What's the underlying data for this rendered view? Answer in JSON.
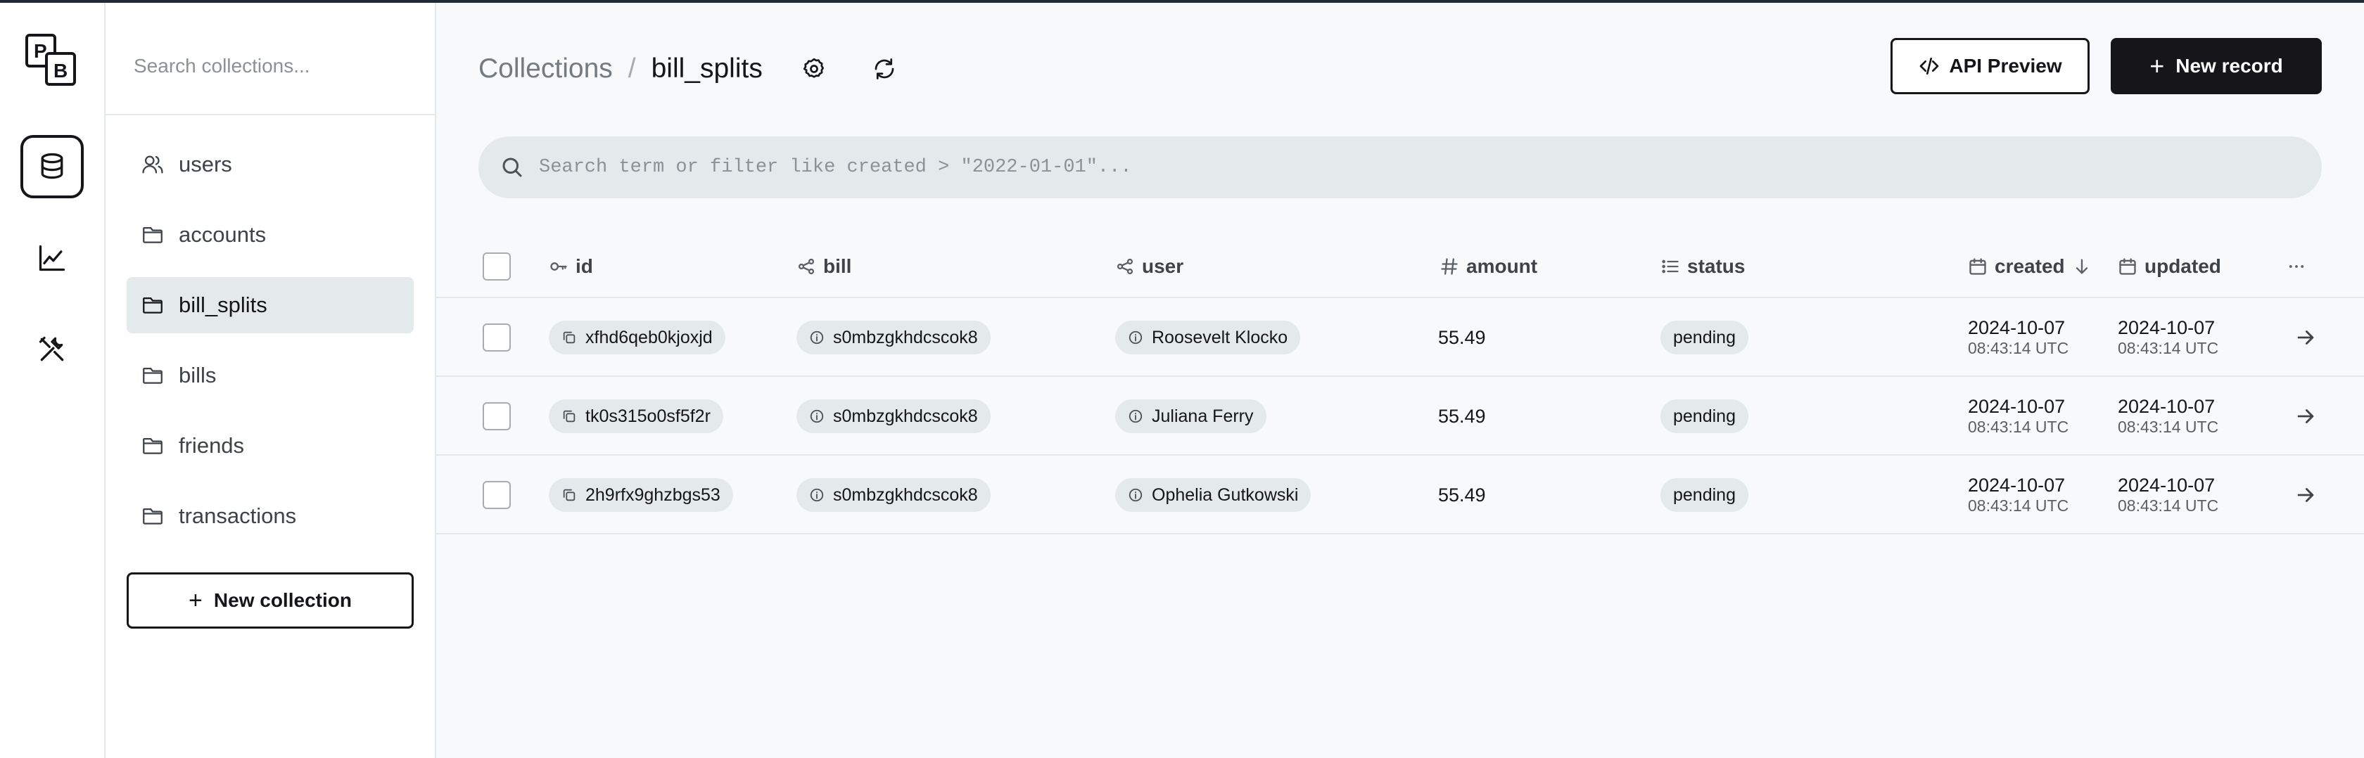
{
  "app": {
    "logo_letters": [
      "P",
      "B"
    ],
    "nav_icons": [
      "database-icon",
      "chart-icon",
      "tools-icon"
    ]
  },
  "sidebar": {
    "search_placeholder": "Search collections...",
    "items": [
      {
        "label": "users",
        "icon": "users-icon"
      },
      {
        "label": "accounts",
        "icon": "folder-icon"
      },
      {
        "label": "bill_splits",
        "icon": "folder-icon",
        "active": true
      },
      {
        "label": "bills",
        "icon": "folder-icon"
      },
      {
        "label": "friends",
        "icon": "folder-icon"
      },
      {
        "label": "transactions",
        "icon": "folder-icon"
      }
    ],
    "new_collection_label": "New collection"
  },
  "header": {
    "breadcrumb_root": "Collections",
    "breadcrumb_separator": "/",
    "breadcrumb_current": "bill_splits",
    "api_preview_label": "API Preview",
    "new_record_label": "New record"
  },
  "search": {
    "placeholder": "Search term or filter like created > \"2022-01-01\"..."
  },
  "table": {
    "columns": [
      {
        "key": "id",
        "label": "id",
        "icon": "key-icon"
      },
      {
        "key": "bill",
        "label": "bill",
        "icon": "relation-icon"
      },
      {
        "key": "user",
        "label": "user",
        "icon": "relation-icon"
      },
      {
        "key": "amount",
        "label": "amount",
        "icon": "hash-icon"
      },
      {
        "key": "status",
        "label": "status",
        "icon": "list-icon"
      },
      {
        "key": "created",
        "label": "created",
        "icon": "calendar-icon",
        "sorted": "desc"
      },
      {
        "key": "updated",
        "label": "updated",
        "icon": "calendar-icon"
      }
    ],
    "rows": [
      {
        "id": "xfhd6qeb0kjoxjd",
        "bill": "s0mbzgkhdcscok8",
        "user": "Roosevelt Klocko",
        "amount": "55.49",
        "status": "pending",
        "created_date": "2024-10-07",
        "created_time": "08:43:14 UTC",
        "updated_date": "2024-10-07",
        "updated_time": "08:43:14 UTC"
      },
      {
        "id": "tk0s315o0sf5f2r",
        "bill": "s0mbzgkhdcscok8",
        "user": "Juliana Ferry",
        "amount": "55.49",
        "status": "pending",
        "created_date": "2024-10-07",
        "created_time": "08:43:14 UTC",
        "updated_date": "2024-10-07",
        "updated_time": "08:43:14 UTC"
      },
      {
        "id": "2h9rfx9ghzbgs53",
        "bill": "s0mbzgkhdcscok8",
        "user": "Ophelia Gutkowski",
        "amount": "55.49",
        "status": "pending",
        "created_date": "2024-10-07",
        "created_time": "08:43:14 UTC",
        "updated_date": "2024-10-07",
        "updated_time": "08:43:14 UTC"
      }
    ]
  }
}
